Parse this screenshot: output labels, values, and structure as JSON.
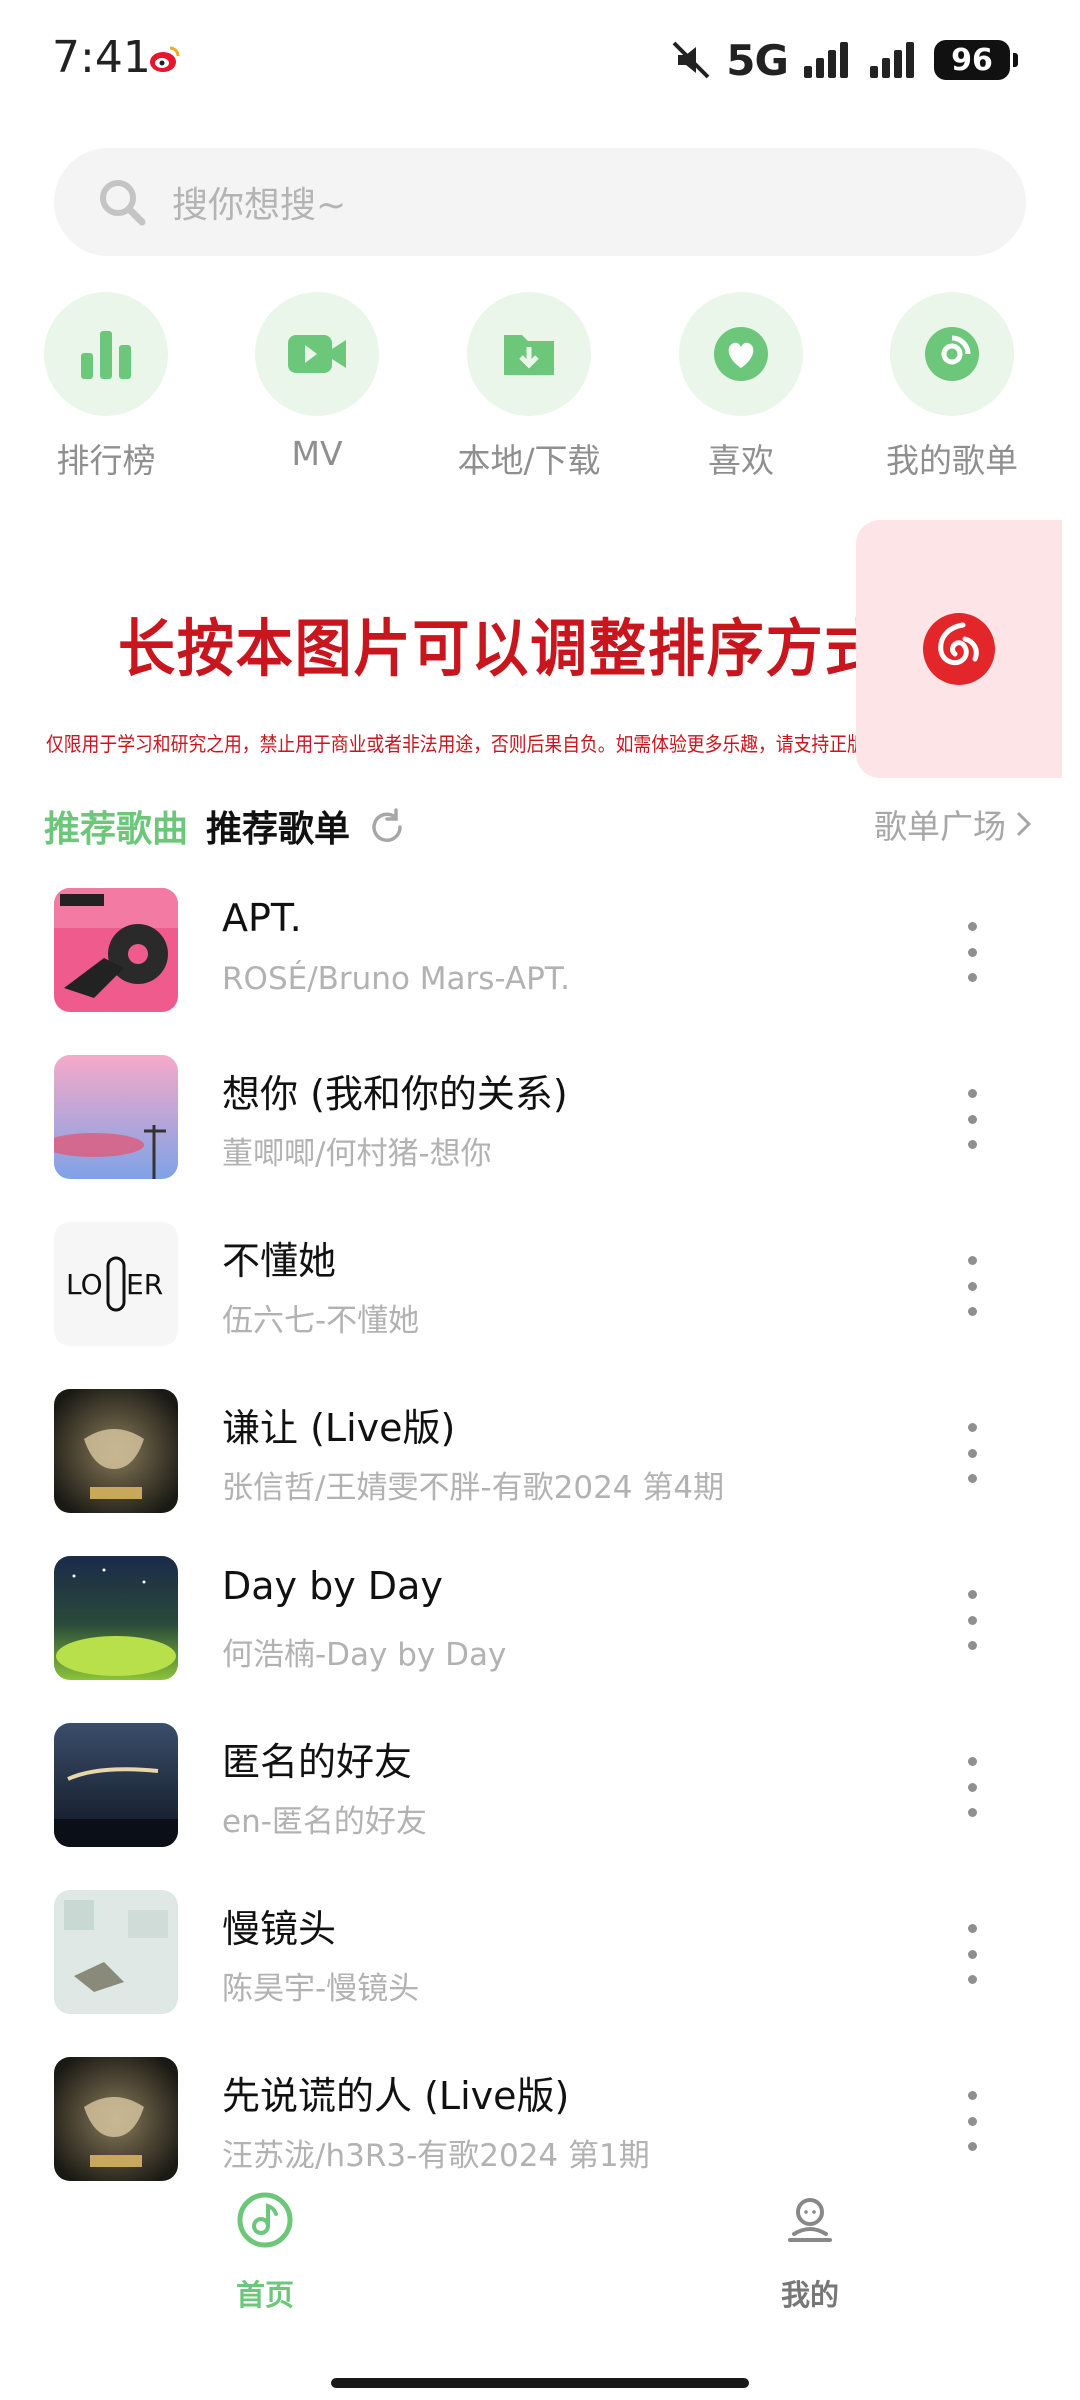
{
  "status_bar": {
    "time": "7:41",
    "network": "5G",
    "battery": "96"
  },
  "search": {
    "placeholder": "搜你想搜~"
  },
  "quick_entries": [
    {
      "label": "排行榜",
      "icon": "chart-bars-icon"
    },
    {
      "label": "MV",
      "icon": "video-icon"
    },
    {
      "label": "本地/下载",
      "icon": "download-folder-icon"
    },
    {
      "label": "喜欢",
      "icon": "heart-icon"
    },
    {
      "label": "我的歌单",
      "icon": "disc-icon"
    }
  ],
  "banner": {
    "title": "长按本图片可以调整排序方式",
    "notice": "仅限用于学习和研究之用，禁止用于商业或者非法用途，否则后果自负。如需体验更多乐趣，请支持正版音乐！"
  },
  "tabs": {
    "recommended_songs": "推荐歌曲",
    "recommended_playlists": "推荐歌单",
    "playlist_square": "歌单广场"
  },
  "songs": [
    {
      "title": "APT.",
      "subtitle": "ROSÉ/Bruno Mars-APT."
    },
    {
      "title": "想你 (我和你的关系)",
      "subtitle": "董唧唧/何村猪-想你"
    },
    {
      "title": "不懂她",
      "subtitle": "伍六七-不懂她"
    },
    {
      "title": "谦让 (Live版)",
      "subtitle": "张信哲/王婧雯不胖-有歌2024 第4期"
    },
    {
      "title": "Day by Day",
      "subtitle": "何浩楠-Day by Day"
    },
    {
      "title": "匿名的好友",
      "subtitle": "en-匿名的好友"
    },
    {
      "title": "慢镜头",
      "subtitle": "陈昊宇-慢镜头"
    },
    {
      "title": "先说谎的人 (Live版)",
      "subtitle": "汪苏泷/h3R3-有歌2024 第1期"
    }
  ],
  "bottom_nav": {
    "home": "首页",
    "mine": "我的"
  },
  "colors": {
    "accent": "#6dc77a",
    "accent_light": "#eaf6ea",
    "banner_red": "#c9161e"
  }
}
